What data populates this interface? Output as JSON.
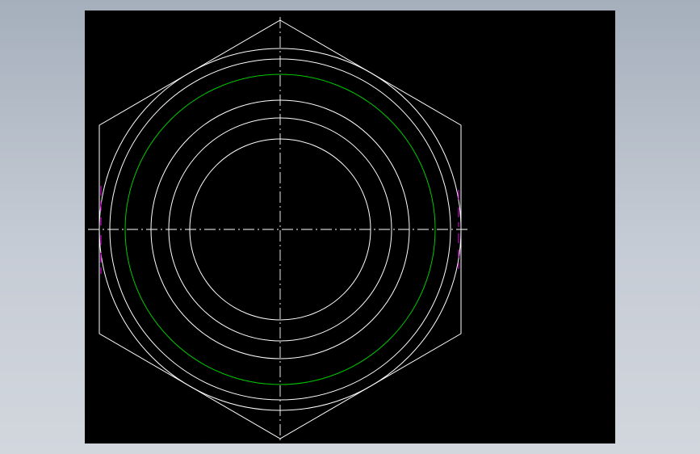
{
  "drawing": {
    "background_color": "#000000",
    "outline_color": "#ffffff",
    "thread_color": "#00c800",
    "centerline_color": "#ffffff",
    "hidden_mark_color": "#c800c8",
    "elements": [
      "hex-nut-outline",
      "chamfer-circle",
      "thread-major-circle",
      "bearing-face-circle",
      "inner-bore-circle",
      "thread-minor-circle",
      "horizontal-centerline",
      "vertical-centerline"
    ]
  }
}
